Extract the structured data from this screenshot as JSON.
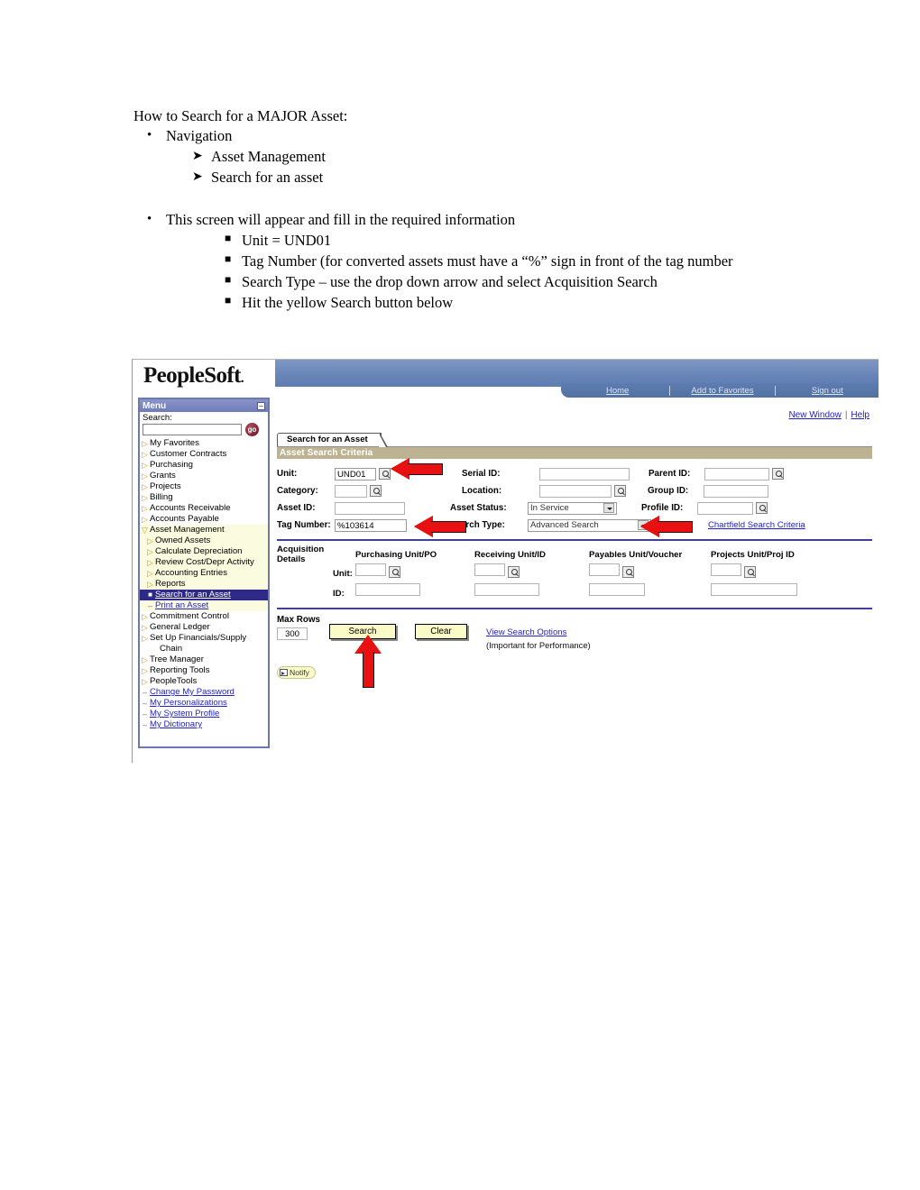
{
  "document": {
    "title": "How to Search for a MAJOR Asset:",
    "bullets": [
      {
        "level": 1,
        "marker": "disc",
        "text": "Navigation"
      },
      {
        "level": 2,
        "marker": "arrow",
        "text": "Asset Management"
      },
      {
        "level": 2,
        "marker": "arrow",
        "text": "Search for an asset"
      },
      {
        "level": 1,
        "marker": "disc",
        "text": "This screen will appear and fill in the required information"
      },
      {
        "level": 3,
        "marker": "square",
        "text": "Unit = UND01"
      },
      {
        "level": 3,
        "marker": "square",
        "text": "Tag Number (for converted assets must have a “%” sign in front of the tag number"
      },
      {
        "level": 3,
        "marker": "square",
        "text": "Search Type – use the drop down arrow and select Acquisition Search"
      },
      {
        "level": 3,
        "marker": "square",
        "text": "Hit the yellow Search button below"
      }
    ]
  },
  "screenshot": {
    "brand": "PeopleSoft",
    "brand_dot": ".",
    "top_nav": [
      {
        "label": "Home"
      },
      {
        "label": "Add to Favorites"
      },
      {
        "label": "Sign out"
      }
    ],
    "top_links": {
      "new_window": "New Window",
      "separator": "|",
      "help": "Help"
    },
    "menu": {
      "header": "Menu",
      "collapse_glyph": "–",
      "search_label": "Search:",
      "search_value": "",
      "go_label": "go",
      "items": [
        {
          "label": "My Favorites",
          "icon": "collapsed-arrow",
          "indent": 0,
          "state": "normal"
        },
        {
          "label": "Customer Contracts",
          "icon": "collapsed-arrow",
          "indent": 0,
          "state": "normal"
        },
        {
          "label": "Purchasing",
          "icon": "collapsed-arrow",
          "indent": 0,
          "state": "normal"
        },
        {
          "label": "Grants",
          "icon": "collapsed-arrow",
          "indent": 0,
          "state": "normal"
        },
        {
          "label": "Projects",
          "icon": "collapsed-arrow",
          "indent": 0,
          "state": "normal"
        },
        {
          "label": "Billing",
          "icon": "collapsed-arrow",
          "indent": 0,
          "state": "normal"
        },
        {
          "label": "Accounts Receivable",
          "icon": "collapsed-arrow",
          "indent": 0,
          "state": "normal"
        },
        {
          "label": "Accounts Payable",
          "icon": "collapsed-arrow",
          "indent": 0,
          "state": "normal"
        },
        {
          "label": "Asset Management",
          "icon": "expanded-arrow",
          "indent": 0,
          "state": "expanded"
        },
        {
          "label": "Owned Assets",
          "icon": "collapsed-arrow",
          "indent": 1,
          "state": "expanded"
        },
        {
          "label": "Calculate Depreciation",
          "icon": "collapsed-arrow",
          "indent": 1,
          "state": "expanded"
        },
        {
          "label": "Review Cost/Depr Activity",
          "icon": "collapsed-arrow",
          "indent": 1,
          "state": "expanded"
        },
        {
          "label": "Accounting Entries",
          "icon": "collapsed-arrow",
          "indent": 1,
          "state": "expanded"
        },
        {
          "label": "Reports",
          "icon": "collapsed-arrow",
          "indent": 1,
          "state": "expanded"
        },
        {
          "label": "Search for an Asset",
          "icon": "square-bullet",
          "indent": 1,
          "state": "selected"
        },
        {
          "label": "Print an Asset",
          "icon": "dash-bullet",
          "indent": 1,
          "state": "link-expanded"
        },
        {
          "label": "Commitment Control",
          "icon": "collapsed-arrow",
          "indent": 0,
          "state": "normal"
        },
        {
          "label": "General Ledger",
          "icon": "collapsed-arrow",
          "indent": 0,
          "state": "normal"
        },
        {
          "label": "Set Up Financials/Supply",
          "icon": "collapsed-arrow",
          "indent": 0,
          "state": "normal",
          "wrap": "Chain"
        },
        {
          "label": "Tree Manager",
          "icon": "collapsed-arrow",
          "indent": 0,
          "state": "normal"
        },
        {
          "label": "Reporting Tools",
          "icon": "collapsed-arrow",
          "indent": 0,
          "state": "normal"
        },
        {
          "label": "PeopleTools",
          "icon": "collapsed-arrow",
          "indent": 0,
          "state": "normal"
        },
        {
          "label": "Change My Password",
          "icon": "dash-bullet",
          "indent": 0,
          "state": "link"
        },
        {
          "label": "My Personalizations",
          "icon": "dash-bullet",
          "indent": 0,
          "state": "link"
        },
        {
          "label": "My System Profile",
          "icon": "dash-bullet",
          "indent": 0,
          "state": "link"
        },
        {
          "label": "My Dictionary",
          "icon": "dash-bullet",
          "indent": 0,
          "state": "link"
        }
      ]
    },
    "page": {
      "tab_label": "Search for an Asset",
      "section_header": "Asset Search Criteria",
      "fields": {
        "unit_label": "Unit:",
        "unit_value": "UND01",
        "category_label": "Category:",
        "category_value": "",
        "asset_id_label": "Asset ID:",
        "asset_id_value": "",
        "tag_number_label": "Tag Number:",
        "tag_number_value": "%103614",
        "serial_id_label": "Serial ID:",
        "serial_id_value": "",
        "location_label": "Location:",
        "location_value": "",
        "asset_status_label": "Asset Status:",
        "asset_status_value": "In Service",
        "search_type_label": "Search Type:",
        "search_type_value": "Advanced Search",
        "parent_id_label": "Parent ID:",
        "parent_id_value": "",
        "group_id_label": "Group ID:",
        "group_id_value": "",
        "profile_id_label": "Profile ID:",
        "profile_id_value": "",
        "chartfield_link": "Chartfield Search Criteria"
      },
      "acquisition": {
        "label_line1": "Acquisition",
        "label_line2": "Details",
        "unit_row_label": "Unit:",
        "id_row_label": "ID:",
        "columns": [
          {
            "header": "Purchasing Unit/PO",
            "unit_value": "",
            "id_value": "",
            "has_lookup": true
          },
          {
            "header": "Receiving Unit/ID",
            "unit_value": "",
            "id_value": "",
            "has_lookup": true
          },
          {
            "header": "Payables Unit/Voucher",
            "unit_value": "",
            "id_value": "",
            "has_lookup": true
          },
          {
            "header": "Projects Unit/Proj ID",
            "unit_value": "",
            "id_value": "",
            "has_lookup": true
          }
        ]
      },
      "footer": {
        "max_rows_label": "Max Rows",
        "max_rows_value": "300",
        "search_button": "Search",
        "clear_button": "Clear",
        "view_search_options": "View Search Options",
        "performance_note": "(Important for Performance)",
        "notify_button": "Notify"
      }
    },
    "annotations": [
      {
        "name": "arrow-unit",
        "direction": "left",
        "target": "unit-field"
      },
      {
        "name": "arrow-tag-number",
        "direction": "left",
        "target": "tag-number-field"
      },
      {
        "name": "arrow-search-type",
        "direction": "left",
        "target": "search-type-dropdown"
      },
      {
        "name": "arrow-search-button",
        "direction": "up",
        "target": "search-button"
      }
    ],
    "colors": {
      "banner_blue": "#5d7cb2",
      "menu_header": "#6f7cb9",
      "section_bar": "#bdb393",
      "selected_item": "#2e2a87",
      "button_yellow": "#fbfbc8",
      "link_blue": "#2222cc",
      "arrow_red": "#e81010",
      "divider_blue": "#40409a"
    }
  }
}
